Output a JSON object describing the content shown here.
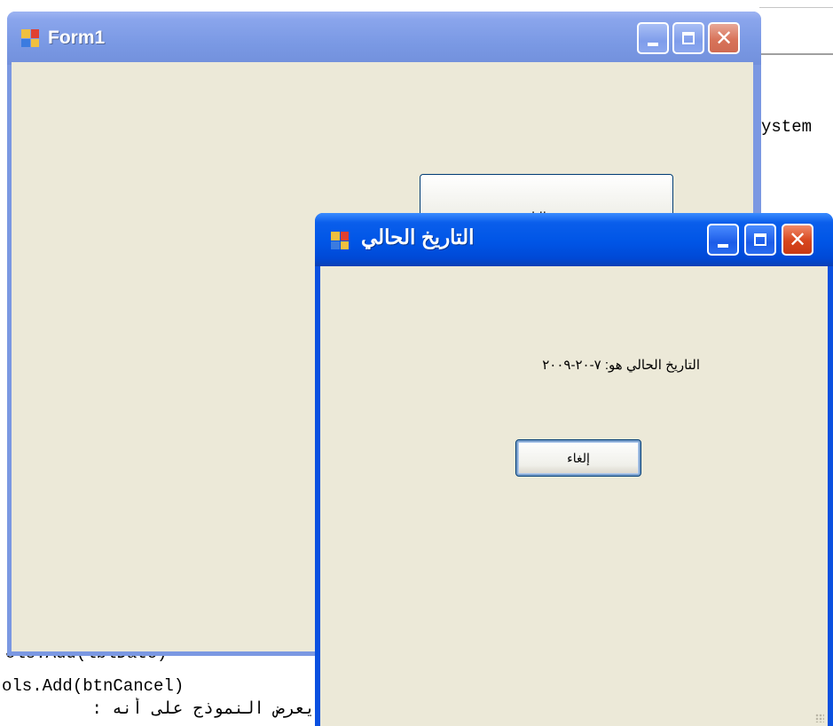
{
  "editor": {
    "partial_text_right": "ystem",
    "code_lines": [
      "ols.Add(lblDate)",
      "ols.Add(btnCancel)",
      "يعرض النموذج على أنه :"
    ]
  },
  "form1": {
    "title": "Form1",
    "button_label": "عرض التاريخ"
  },
  "dialog": {
    "title": "التاريخ الحالي",
    "date_label": "التاريخ الحالي هو: ٧-٢٠-٢٠٠٩",
    "cancel_label": "إلغاء"
  },
  "colors": {
    "active_titlebar": "#0055e6",
    "inactive_titlebar": "#7a99e4",
    "client_bg": "#ece9d8"
  },
  "icons": [
    "app-icon",
    "minimize-icon",
    "maximize-icon",
    "close-icon"
  ]
}
